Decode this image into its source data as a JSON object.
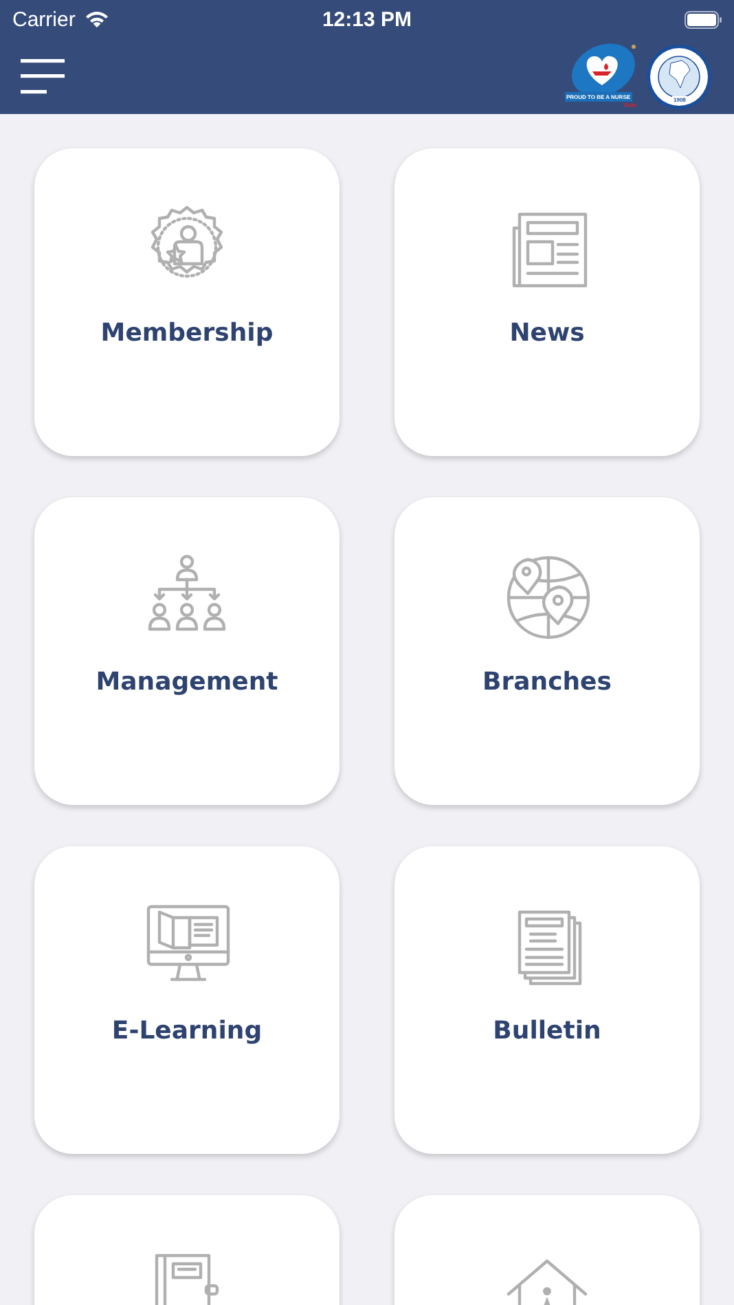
{
  "status_bar": {
    "carrier": "Carrier",
    "time": "12:13 PM"
  },
  "header": {
    "logo_caption": "PROUD TO BE A NURSE",
    "logo_mark": "TNAI",
    "seal_year": "1908"
  },
  "tiles": [
    {
      "kind": "membership",
      "label": "Membership"
    },
    {
      "kind": "news",
      "label": "News"
    },
    {
      "kind": "management",
      "label": "Management"
    },
    {
      "kind": "branches",
      "label": "Branches"
    },
    {
      "kind": "elearning",
      "label": "E-Learning"
    },
    {
      "kind": "bulletin",
      "label": "Bulletin"
    },
    {
      "kind": "notebook"
    },
    {
      "kind": "house"
    }
  ]
}
